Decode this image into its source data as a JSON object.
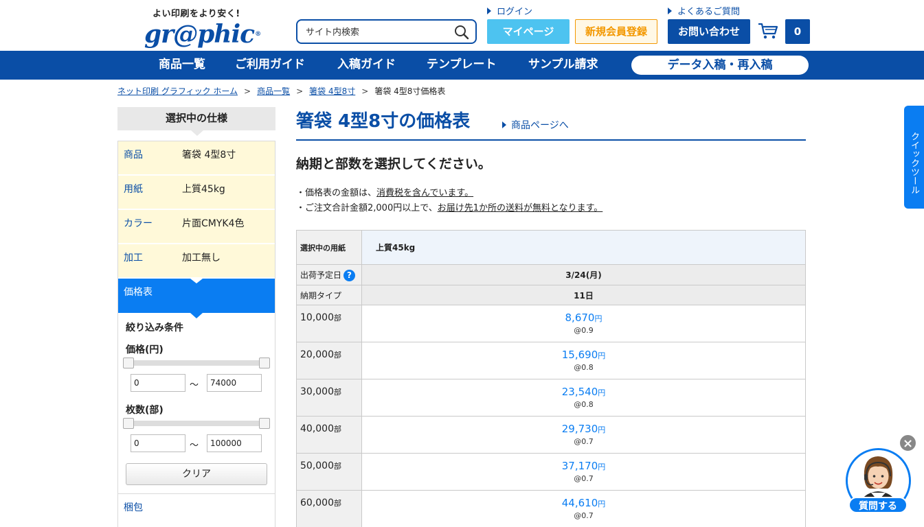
{
  "header": {
    "tagline": "よい印刷をより安く!",
    "logo": "gr@phic",
    "logo_mark": "®",
    "search_placeholder": "サイト内検索",
    "login": "ログイン",
    "faq": "よくあるご質問",
    "mypage": "マイページ",
    "register": "新規会員登録",
    "contact": "お問い合わせ",
    "cart_count": "0"
  },
  "nav": {
    "items": [
      "商品一覧",
      "ご利用ガイド",
      "入稿ガイド",
      "テンプレート",
      "サンプル請求"
    ],
    "pill": "データ入稿・再入稿"
  },
  "breadcrumb": {
    "items": [
      "ネット印刷 グラフィック ホーム",
      "商品一覧",
      "箸袋 4型8寸"
    ],
    "current": "箸袋 4型8寸価格表",
    "sep": ">"
  },
  "sidebar": {
    "heading": "選択中の仕様",
    "specs": [
      {
        "key": "商品",
        "value": "箸袋 4型8寸"
      },
      {
        "key": "用紙",
        "value": "上質45kg"
      },
      {
        "key": "カラー",
        "value": "片面CMYK4色"
      },
      {
        "key": "加工",
        "value": "加工無し"
      }
    ],
    "price_tab": "価格表",
    "filter_title": "絞り込み条件",
    "price_label": "価格(円)",
    "price_min": "0",
    "price_max": "74000",
    "qty_label": "枚数(部)",
    "qty_min": "0",
    "qty_max": "100000",
    "tilde": "〜",
    "clear": "クリア",
    "packing": "梱包"
  },
  "main": {
    "title": "箸袋 4型8寸の価格表",
    "product_link": "商品ページへ",
    "subhead": "納期と部数を選択してください。",
    "note1_pre": "・価格表の金額は、",
    "note1_link": "消費税を含んでいます。",
    "note2_pre": "・ご注文合計金額2,000円以上で、",
    "note2_link": "お届け先1か所の送料が無料となります。",
    "table": {
      "paper_label": "選択中の用紙",
      "paper_value": "上質45kg",
      "ship_label": "出荷予定日",
      "ship_help": "?",
      "ship_value": "3/24(月)",
      "type_label": "納期タイプ",
      "type_value": "11日",
      "qty_unit": "部",
      "yen": "円",
      "rows": [
        {
          "qty": "10,000",
          "price": "8,670",
          "unit": "@0.9"
        },
        {
          "qty": "20,000",
          "price": "15,690",
          "unit": "@0.8"
        },
        {
          "qty": "30,000",
          "price": "23,540",
          "unit": "@0.8"
        },
        {
          "qty": "40,000",
          "price": "29,730",
          "unit": "@0.7"
        },
        {
          "qty": "50,000",
          "price": "37,170",
          "unit": "@0.7"
        },
        {
          "qty": "60,000",
          "price": "44,610",
          "unit": "@0.7"
        }
      ]
    }
  },
  "quick_tool": "クイックツール",
  "chat": {
    "label": "質問する",
    "close": "×"
  },
  "colors": {
    "brand": "#0a4ea6",
    "accent": "#0a7df2",
    "mypage": "#4dc3f0",
    "register": "#f39800",
    "spec_bg": "#fff9d9"
  }
}
